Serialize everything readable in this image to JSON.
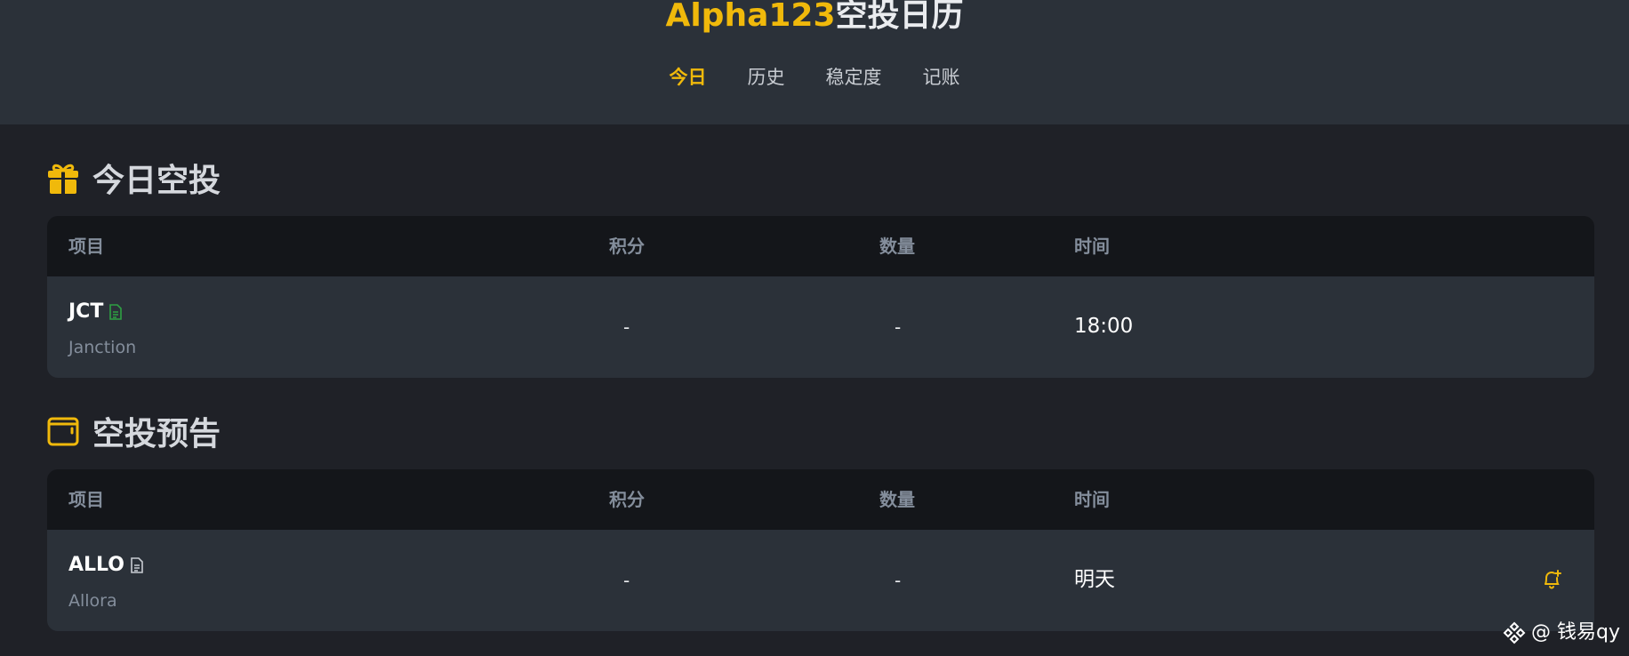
{
  "header": {
    "title_accent": "Alpha123",
    "title_rest": "空投日历",
    "nav": [
      {
        "label": "今日",
        "active": true
      },
      {
        "label": "历史",
        "active": false
      },
      {
        "label": "稳定度",
        "active": false
      },
      {
        "label": "记账",
        "active": false
      }
    ]
  },
  "colors": {
    "accent": "#f0b90b",
    "bg": "#1f2127",
    "panel": "#2b3139",
    "table_head": "#14161a",
    "muted": "#848e9c",
    "doc_green": "#2ea043"
  },
  "today": {
    "icon": "gift-icon",
    "title": "今日空投",
    "columns": {
      "project": "项目",
      "points": "积分",
      "quantity": "数量",
      "time": "时间"
    },
    "rows": [
      {
        "symbol": "JCT",
        "name": "Janction",
        "points": "-",
        "quantity": "-",
        "time": "18:00",
        "doc_icon": "document-icon"
      }
    ]
  },
  "upcoming": {
    "icon": "wallet-icon",
    "title": "空投预告",
    "columns": {
      "project": "项目",
      "points": "积分",
      "quantity": "数量",
      "time": "时间"
    },
    "rows": [
      {
        "symbol": "ALLO",
        "name": "Allora",
        "points": "-",
        "quantity": "-",
        "time": "明天",
        "doc_icon": "document-icon",
        "action_icon": "bell-plus-icon"
      }
    ]
  },
  "watermark": {
    "text": "@ 钱易qy",
    "icon": "binance-logo-icon"
  }
}
